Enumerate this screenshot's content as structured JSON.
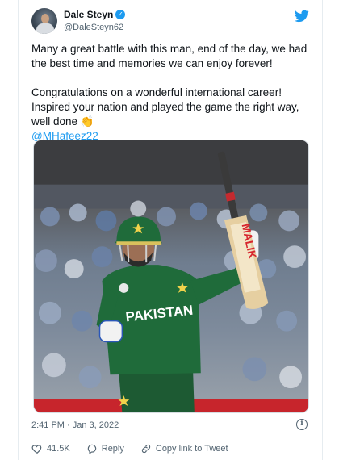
{
  "tweet": {
    "author": {
      "display_name": "Dale Steyn",
      "handle": "@DaleSteyn62",
      "verified": true
    },
    "text_paragraph_1": "Many a great battle with this man, end of the day, we had the best time and memories we can enjoy forever!",
    "text_paragraph_2": "Congratulations on a wonderful international career! Inspired your nation and played the game the right way, well done",
    "emoji": "👏",
    "mention": "@MHafeez22",
    "timestamp": "2:41 PM · Jan 3, 2022",
    "actions": {
      "likes": "41.5K",
      "reply_label": "Reply",
      "copy_link_label": "Copy link to Tweet"
    },
    "media": {
      "jersey_text": "PAKISTAN",
      "bat_brand": "MALIK"
    }
  },
  "colors": {
    "accent": "#1d9bf0",
    "jersey_green": "#1f6b3a",
    "bat_red": "#d7262e"
  },
  "icons": [
    "twitter-bird-icon",
    "verified-badge-icon",
    "info-icon",
    "heart-icon",
    "reply-icon",
    "link-icon"
  ]
}
